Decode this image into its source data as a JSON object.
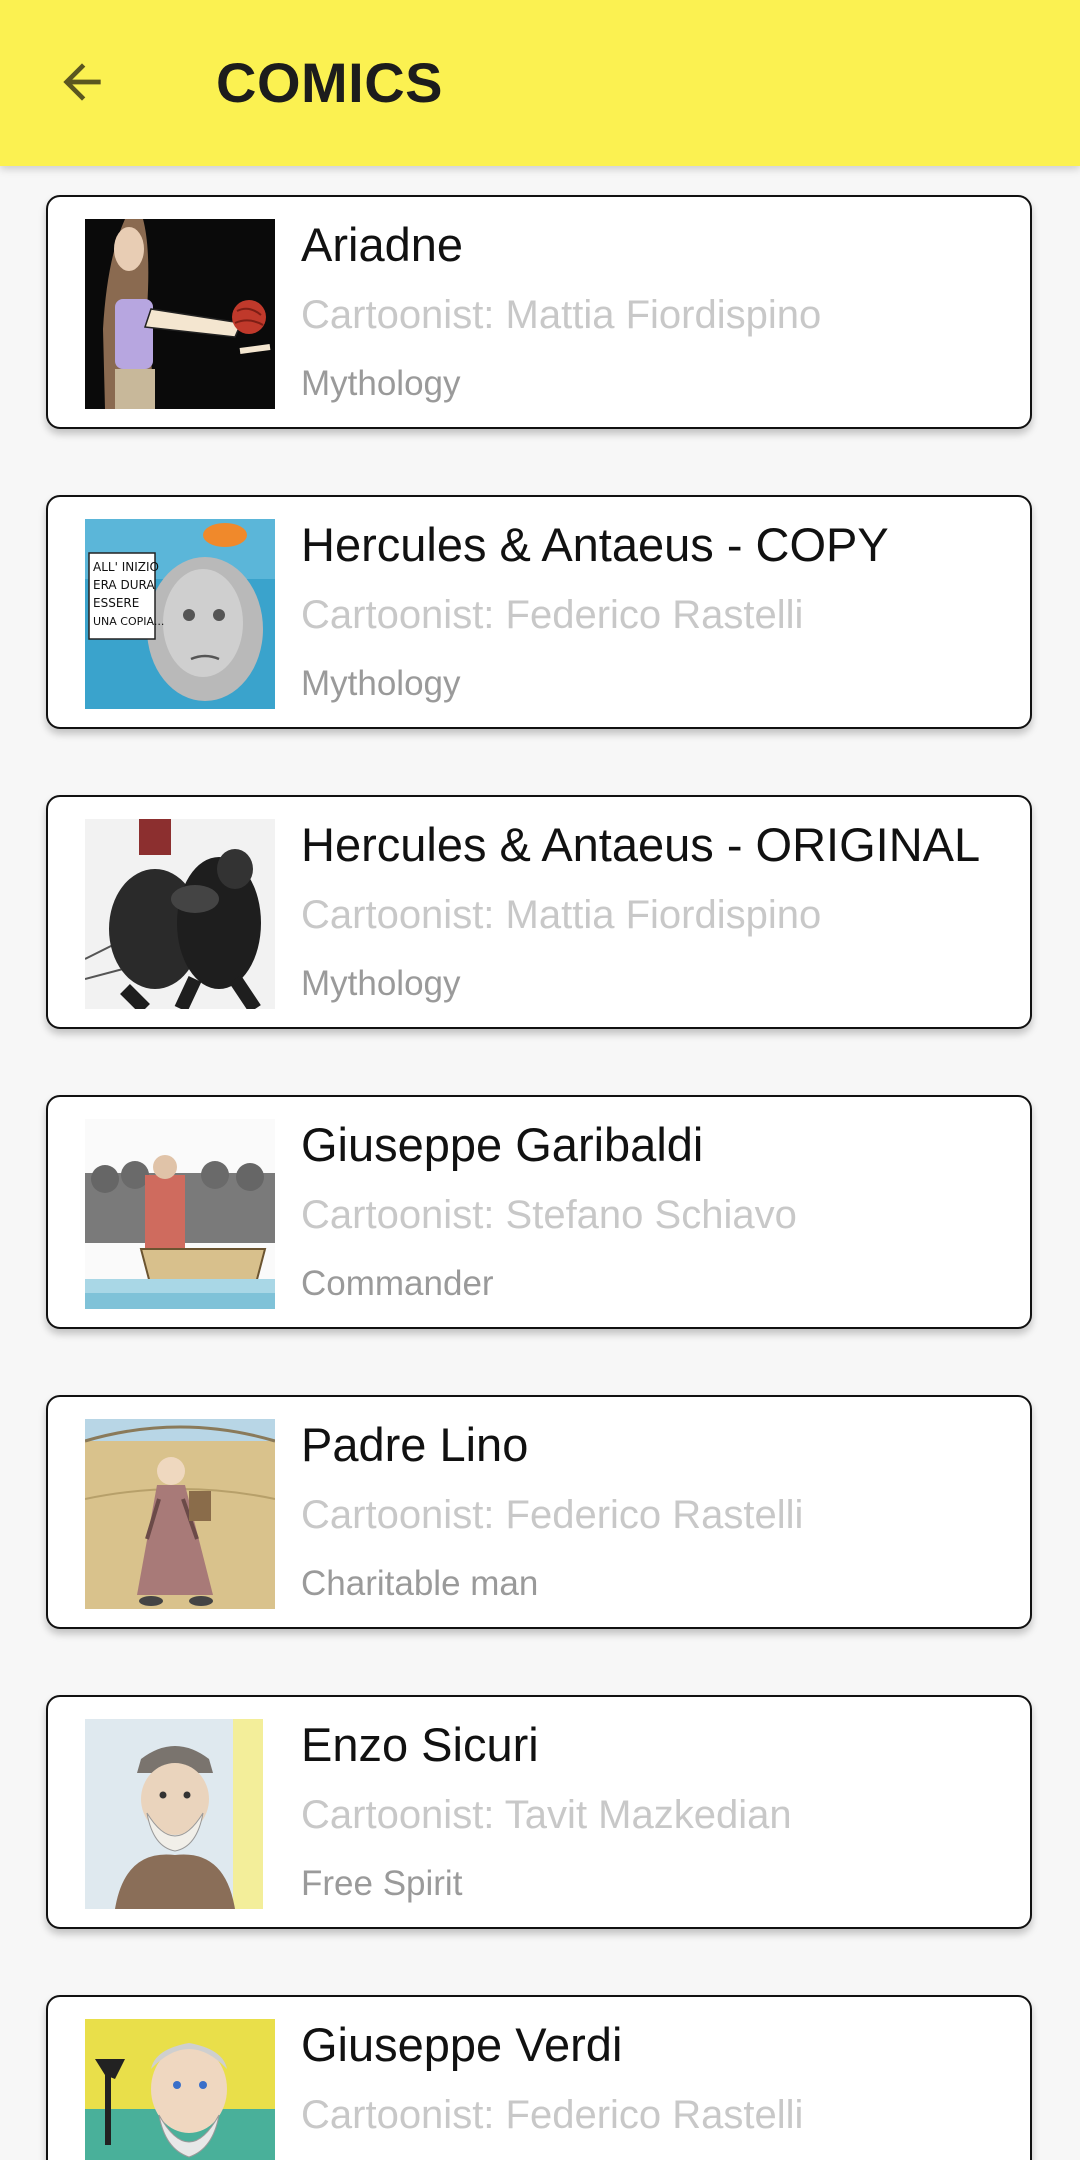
{
  "appbar": {
    "title": "COMICS",
    "background": "#fbf151",
    "back_icon": "arrow-left-icon"
  },
  "comics": [
    {
      "title": "Ariadne",
      "cartoonist": "Cartoonist: Mattia Fiordispino",
      "category": "Mythology"
    },
    {
      "title": "Hercules & Antaeus - COPY",
      "cartoonist": "Cartoonist: Federico Rastelli",
      "category": "Mythology",
      "thumb_text": [
        "ALL' INIZIO",
        "ERA DURA",
        "ESSERE",
        "UNA COPIA..."
      ]
    },
    {
      "title": "Hercules & Antaeus - ORIGINAL",
      "cartoonist": "Cartoonist: Mattia Fiordispino",
      "category": "Mythology"
    },
    {
      "title": "Giuseppe Garibaldi",
      "cartoonist": "Cartoonist: Stefano Schiavo",
      "category": "Commander"
    },
    {
      "title": "Padre Lino",
      "cartoonist": "Cartoonist: Federico Rastelli",
      "category": "Charitable man"
    },
    {
      "title": "Enzo Sicuri",
      "cartoonist": "Cartoonist: Tavit Mazkedian",
      "category": "Free Spirit"
    },
    {
      "title": "Giuseppe Verdi",
      "cartoonist": "Cartoonist: Federico Rastelli",
      "category": ""
    }
  ]
}
